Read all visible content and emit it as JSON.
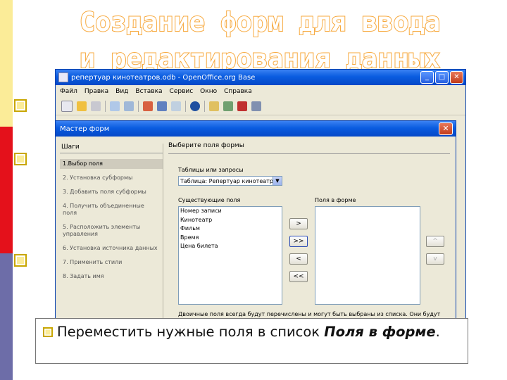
{
  "slide": {
    "title_line1": "Создание форм для ввода",
    "title_line2": "и редактирования данных",
    "colors": {
      "stripe_top": "#fbec98",
      "stripe_mid": "#e4111b",
      "stripe_bottom": "#6d6da8",
      "title_outline": "#f7a93e"
    },
    "caption": {
      "bullet_icon": "square-bullet-icon",
      "text_plain": "Переместить нужные поля в список ",
      "text_italic": "Поля в форме",
      "text_end": "."
    }
  },
  "app_window": {
    "title": "репертуар кинотеатров.odb - OpenOffice.org Base",
    "menu": [
      "Файл",
      "Правка",
      "Вид",
      "Вставка",
      "Сервис",
      "Окно",
      "Справка"
    ]
  },
  "wizard": {
    "title": "Мастер форм",
    "steps_header": "Шаги",
    "steps": [
      "1.Выбор поля",
      "2. Установка субформы",
      "3. Добавить поля субформы",
      "4. Получить объединенные поля",
      "5. Расположить элементы управления",
      "6. Установка источника данных",
      "7. Применить стили",
      "8. Задать имя"
    ],
    "active_step": 0,
    "pane_title": "Выберите поля формы",
    "tables_label": "Таблицы или запросы",
    "table_value": "Таблица: Репертуар кинотеатр",
    "existing_label": "Существующие поля",
    "existing_fields": [
      "Номер записи",
      "Кинотеатр",
      "Фильм",
      "Время",
      "Цена билета"
    ],
    "form_fields_label": "Поля в форме",
    "form_fields": [],
    "buttons": {
      "add_one": ">",
      "add_all": ">>",
      "remove_one": "<",
      "remove_all": "<<",
      "up": "^",
      "down": "v"
    },
    "note": "Двоичные поля всегда будут перечислены и могут быть выбраны из списка. Они будут отображены как изображения, если это возможно."
  }
}
